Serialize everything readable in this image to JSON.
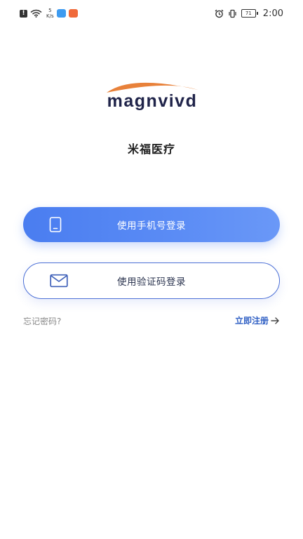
{
  "status_bar": {
    "alert_glyph": "!",
    "net_speed_value": "5",
    "net_speed_unit": "K/s",
    "battery_level": "71",
    "time": "2:00",
    "icons": [
      "alert-icon",
      "wifi-icon",
      "search-app-icon",
      "wallet-app-icon",
      "alarm-icon",
      "vibrate-icon",
      "battery-icon"
    ]
  },
  "logo": {
    "text": "magnvivd",
    "arc_color": "#e8813a",
    "text_color": "#20244a"
  },
  "app_name": "米福医疗",
  "buttons": {
    "phone_login": {
      "label": "使用手机号登录",
      "icon": "phone-icon"
    },
    "code_login": {
      "label": "使用验证码登录",
      "icon": "mail-icon"
    }
  },
  "links": {
    "forgot_password": "忘记密码?",
    "register": "立即注册",
    "register_icon": "arrow-right-icon"
  },
  "colors": {
    "primary": "#4a7df0",
    "link": "#2f5fc4",
    "muted": "#888888"
  }
}
